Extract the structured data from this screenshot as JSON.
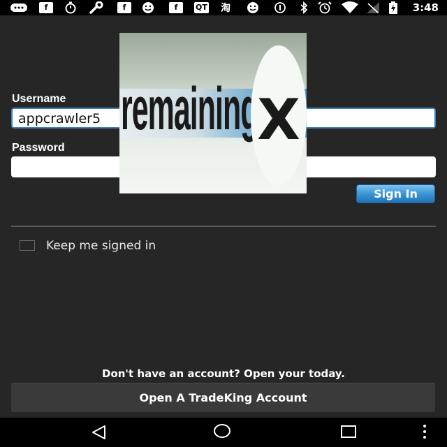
{
  "status_bar": {
    "time": "3:48",
    "icons": [
      "chat-icon",
      "facebook-icon",
      "stopwatch-icon",
      "wrench-icon",
      "facebook-icon",
      "smiley-icon",
      "facebook-icon",
      "qt-icon",
      "taobao-icon",
      "smiley-icon",
      "info-icon",
      "bluetooth-icon",
      "alarm-icon",
      "wifi-icon",
      "no-signal-icon",
      "battery-charging-icon"
    ],
    "qt_label": "QT",
    "taobao_label": "淘"
  },
  "login": {
    "username_label": "Username",
    "username_value": "appcrawler5",
    "password_label": "Password",
    "password_value": "",
    "signin_label": "Sign In",
    "keep_signed_in_label": "Keep me signed in",
    "keep_signed_in_checked": false
  },
  "footer": {
    "promo_text": "Don't have an account? Open your today.",
    "open_account_label": "Open A TradeKing Account"
  },
  "ad": {
    "text": "remaining",
    "close_glyph": "X"
  },
  "colors": {
    "background": "#262626",
    "accent": "#3b95d5",
    "field_focus": "#3d7fb8"
  }
}
